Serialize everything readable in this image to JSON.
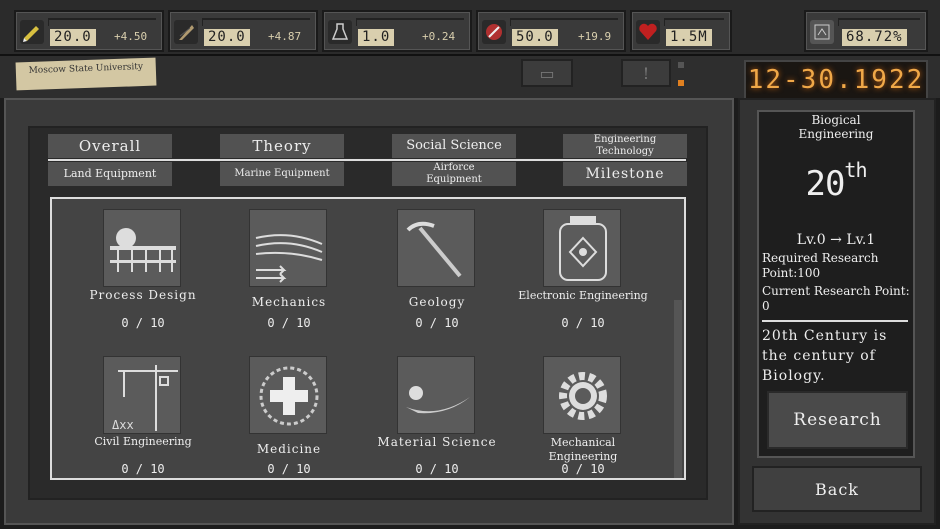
{
  "resources": [
    {
      "name": "pencil-icon",
      "value": "20.0",
      "delta": "+4.50",
      "color": "#c8b640"
    },
    {
      "name": "quill-icon",
      "value": "20.0",
      "delta": "+4.87",
      "color": "#8a7a5a"
    },
    {
      "name": "flask-icon",
      "value": "1.0",
      "delta": "+0.24",
      "color": "#777777"
    },
    {
      "name": "tools-icon",
      "value": "50.0",
      "delta": "+19.9",
      "color": "#b03030"
    },
    {
      "name": "heart-icon",
      "value": "1.5M",
      "delta": "",
      "color": "#c02020"
    }
  ],
  "progress": {
    "value": "68.72%"
  },
  "university": "Moscow State University",
  "date": "12-30.1922",
  "tabs": {
    "overall": "Overall",
    "theory": "Theory",
    "social_science": "Social Science",
    "engineering_technology": "Engineering Technology",
    "land_equipment": "Land Equipment",
    "marine_equipment": "Marine Equipment",
    "airforce_equipment": "Airforce Equipment",
    "milestone": "Milestone"
  },
  "research_items": [
    {
      "name": "Process Design",
      "progress": "0 / 10"
    },
    {
      "name": "Mechanics",
      "progress": "0 / 10"
    },
    {
      "name": "Geology",
      "progress": "0 / 10"
    },
    {
      "name": "Electronic Engineering",
      "progress": "0 / 10"
    },
    {
      "name": "Civil Engineering",
      "progress": "0 / 10"
    },
    {
      "name": "Medicine",
      "progress": "0 / 10"
    },
    {
      "name": "Material Science",
      "progress": "0 / 10"
    },
    {
      "name": "Mechanical Engineering",
      "progress": "0 / 10"
    }
  ],
  "detail": {
    "title": "Biogical Engineering",
    "century": "20",
    "century_suffix": "th",
    "level": "Lv.0 → Lv.1",
    "required_label": "Required Research Point:",
    "required_value": "100",
    "current_label": "Current Research Point:",
    "current_value": "0",
    "quote": "20th Century is the century of Biology.",
    "research_button": "Research"
  },
  "back_button": "Back"
}
